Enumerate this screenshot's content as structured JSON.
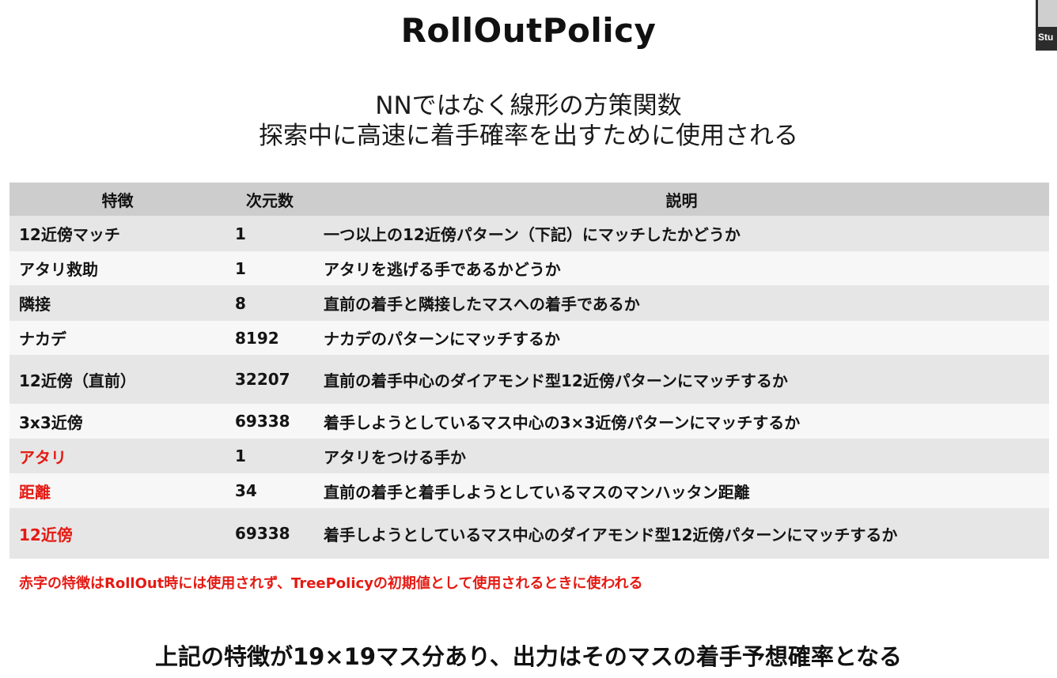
{
  "slide": {
    "title": "RollOutPolicy",
    "subtitle_lines": [
      "NNではなく線形の方策関数",
      "探索中に高速に着手確率を出すために使用される"
    ],
    "corner_label": "Stu",
    "table": {
      "headers": [
        "特徴",
        "次元数",
        "説明"
      ],
      "rows": [
        {
          "feature": "12近傍マッチ",
          "dims": "1",
          "desc": "一つ以上の12近傍パターン（下記）にマッチしたかどうか",
          "red": false
        },
        {
          "feature": "アタリ救助",
          "dims": "1",
          "desc": "アタリを逃げる手であるかどうか",
          "red": false
        },
        {
          "feature": "隣接",
          "dims": "8",
          "desc": "直前の着手と隣接したマスへの着手であるか",
          "red": false
        },
        {
          "feature": "ナカデ",
          "dims": "8192",
          "desc": "ナカデのパターンにマッチするか",
          "red": false
        },
        {
          "feature": "12近傍（直前）",
          "dims": "32207",
          "desc": "直前の着手中心のダイアモンド型12近傍パターンにマッチするか",
          "red": false
        },
        {
          "feature": "3x3近傍",
          "dims": "69338",
          "desc": "着手しようとしているマス中心の3×3近傍パターンにマッチするか",
          "red": false
        },
        {
          "feature": "アタリ",
          "dims": "1",
          "desc": "アタリをつける手か",
          "red": true
        },
        {
          "feature": "距離",
          "dims": "34",
          "desc": "直前の着手と着手しようとしているマスのマンハッタン距離",
          "red": true
        },
        {
          "feature": "12近傍",
          "dims": "69338",
          "desc": "着手しようとしているマス中心のダイアモンド型12近傍パターンにマッチするか",
          "red": true
        }
      ]
    },
    "note": "赤字の特徴はRollOut時には使用されず、TreePolicyの初期値として使用されるときに使われる",
    "bottom_text": "上記の特徴が19×19マス分あり、出力はそのマスの着手予想確率となる",
    "colors": {
      "red_text": "#e41a13",
      "header_bg": "#cdcdcd",
      "row_odd_bg": "#e6e6e6",
      "row_even_bg": "#f7f7f7"
    }
  }
}
